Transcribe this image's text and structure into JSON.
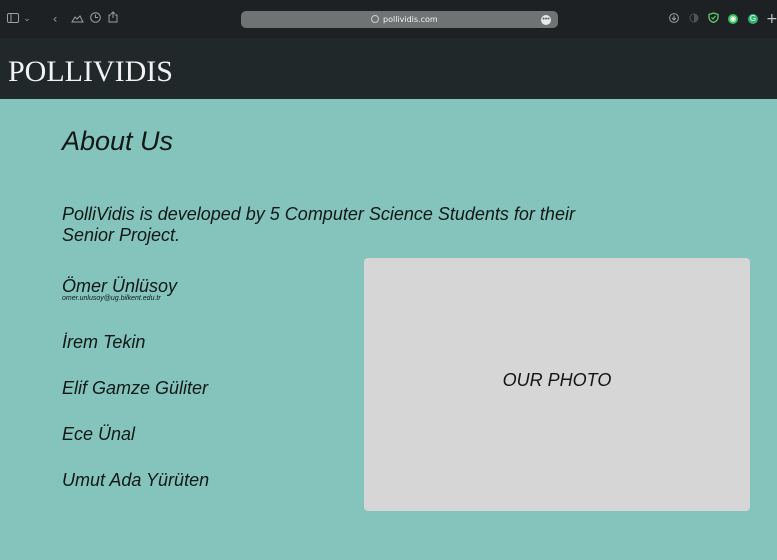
{
  "browser": {
    "url": "pollividis.com",
    "icons": {
      "sidebar": "sidebar-icon",
      "back": "chevron-left-icon",
      "cloud": "cloud-icon",
      "history": "clock-icon",
      "share": "share-icon",
      "more": "ellipsis-icon",
      "download": "download-icon",
      "theme": "half-circle-icon",
      "shield": "shield-icon",
      "camera": "camera-icon",
      "grammarly": "g-icon",
      "new_tab": "plus-icon"
    }
  },
  "site": {
    "logo": "POLLIVIDIS"
  },
  "about": {
    "title": "About Us",
    "intro": "PolliVidis is developed by 5 Computer Science Students for their Senior Project.",
    "members": [
      {
        "name": "Ömer Ünlüsoy",
        "email": "omer.unlusoy@ug.bilkent.edu.tr"
      },
      {
        "name": "İrem Tekin"
      },
      {
        "name": "Elif Gamze Güliter"
      },
      {
        "name": "Ece Ünal"
      },
      {
        "name": "Umut Ada Yürüten"
      }
    ],
    "photo_label": "OUR PHOTO"
  },
  "colors": {
    "page_background": "#84c4bd",
    "header_background": "#21282a",
    "browser_chrome": "#1d2123",
    "photo_placeholder": "#d6d6d6"
  }
}
